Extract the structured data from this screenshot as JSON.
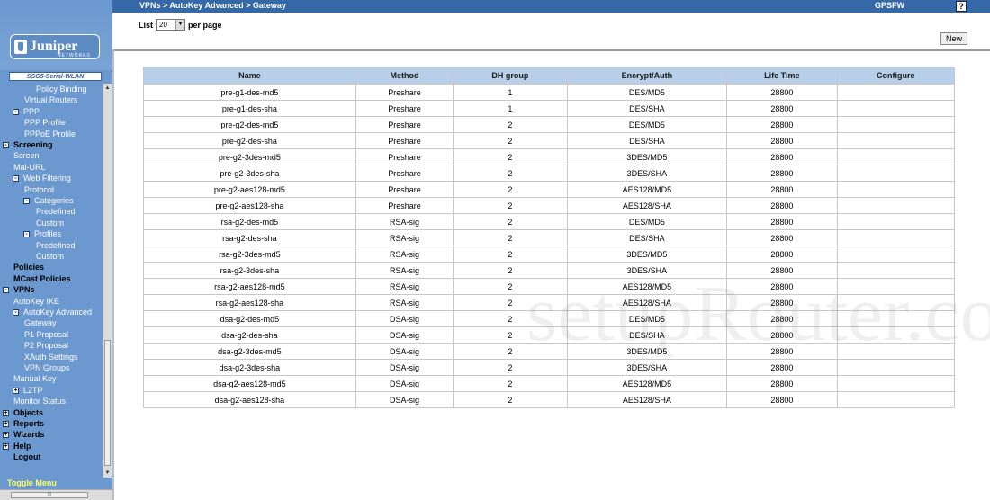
{
  "topbar": {
    "breadcrumb": "VPNs > AutoKey Advanced > Gateway",
    "device_name": "GPSFW",
    "help_label": "?"
  },
  "logo": {
    "text": "Juniper",
    "sub": "NETWORKS",
    "device_label": "SSG5-Serial-WLAN"
  },
  "menu": [
    {
      "label": "Policy Binding",
      "level": 3,
      "bold": false
    },
    {
      "label": "Virtual Routers",
      "level": 2,
      "bold": false
    },
    {
      "label": "PPP",
      "level": 1,
      "bold": false,
      "box": "-"
    },
    {
      "label": "PPP Profile",
      "level": 2,
      "bold": false
    },
    {
      "label": "PPPoE Profile",
      "level": 2,
      "bold": false
    },
    {
      "label": "Screening",
      "level": 0,
      "bold": true,
      "box": "-"
    },
    {
      "label": "Screen",
      "level": 1,
      "bold": false
    },
    {
      "label": "Mal-URL",
      "level": 1,
      "bold": false
    },
    {
      "label": "Web Filtering",
      "level": 1,
      "bold": false,
      "box": "-"
    },
    {
      "label": "Protocol",
      "level": 2,
      "bold": false
    },
    {
      "label": "Categories",
      "level": 2,
      "bold": false,
      "box": "-"
    },
    {
      "label": "Predefined",
      "level": 3,
      "bold": false
    },
    {
      "label": "Custom",
      "level": 3,
      "bold": false
    },
    {
      "label": "Profiles",
      "level": 2,
      "bold": false,
      "box": "-"
    },
    {
      "label": "Predefined",
      "level": 3,
      "bold": false
    },
    {
      "label": "Custom",
      "level": 3,
      "bold": false
    },
    {
      "label": "Policies",
      "level": 0,
      "bold": true
    },
    {
      "label": "MCast Policies",
      "level": 0,
      "bold": true
    },
    {
      "label": "VPNs",
      "level": 0,
      "bold": true,
      "box": "-"
    },
    {
      "label": "AutoKey IKE",
      "level": 1,
      "bold": false
    },
    {
      "label": "AutoKey Advanced",
      "level": 1,
      "bold": false,
      "box": "-"
    },
    {
      "label": "Gateway",
      "level": 2,
      "bold": false
    },
    {
      "label": "P1 Proposal",
      "level": 2,
      "bold": false
    },
    {
      "label": "P2 Proposal",
      "level": 2,
      "bold": false
    },
    {
      "label": "XAuth Settings",
      "level": 2,
      "bold": false
    },
    {
      "label": "VPN Groups",
      "level": 2,
      "bold": false
    },
    {
      "label": "Manual Key",
      "level": 1,
      "bold": false
    },
    {
      "label": "L2TP",
      "level": 1,
      "bold": false,
      "box": "+"
    },
    {
      "label": "Monitor Status",
      "level": 1,
      "bold": false
    },
    {
      "label": "Objects",
      "level": 0,
      "bold": true,
      "box": "+"
    },
    {
      "label": "Reports",
      "level": 0,
      "bold": true,
      "box": "+"
    },
    {
      "label": "Wizards",
      "level": 0,
      "bold": true,
      "box": "+"
    },
    {
      "label": "Help",
      "level": 0,
      "bold": true,
      "box": "+"
    },
    {
      "label": "Logout",
      "level": 0,
      "bold": true
    }
  ],
  "toggle_menu_label": "Toggle Menu",
  "list": {
    "prefix": "List",
    "value": "20",
    "suffix": "per page"
  },
  "new_button_label": "New",
  "table": {
    "columns": [
      "Name",
      "Method",
      "DH group",
      "Encrypt/Auth",
      "Life Time",
      "Configure"
    ],
    "rows": [
      [
        "pre-g1-des-md5",
        "Preshare",
        "1",
        "DES/MD5",
        "28800",
        ""
      ],
      [
        "pre-g1-des-sha",
        "Preshare",
        "1",
        "DES/SHA",
        "28800",
        ""
      ],
      [
        "pre-g2-des-md5",
        "Preshare",
        "2",
        "DES/MD5",
        "28800",
        ""
      ],
      [
        "pre-g2-des-sha",
        "Preshare",
        "2",
        "DES/SHA",
        "28800",
        ""
      ],
      [
        "pre-g2-3des-md5",
        "Preshare",
        "2",
        "3DES/MD5",
        "28800",
        ""
      ],
      [
        "pre-g2-3des-sha",
        "Preshare",
        "2",
        "3DES/SHA",
        "28800",
        ""
      ],
      [
        "pre-g2-aes128-md5",
        "Preshare",
        "2",
        "AES128/MD5",
        "28800",
        ""
      ],
      [
        "pre-g2-aes128-sha",
        "Preshare",
        "2",
        "AES128/SHA",
        "28800",
        ""
      ],
      [
        "rsa-g2-des-md5",
        "RSA-sig",
        "2",
        "DES/MD5",
        "28800",
        ""
      ],
      [
        "rsa-g2-des-sha",
        "RSA-sig",
        "2",
        "DES/SHA",
        "28800",
        ""
      ],
      [
        "rsa-g2-3des-md5",
        "RSA-sig",
        "2",
        "3DES/MD5",
        "28800",
        ""
      ],
      [
        "rsa-g2-3des-sha",
        "RSA-sig",
        "2",
        "3DES/SHA",
        "28800",
        ""
      ],
      [
        "rsa-g2-aes128-md5",
        "RSA-sig",
        "2",
        "AES128/MD5",
        "28800",
        ""
      ],
      [
        "rsa-g2-aes128-sha",
        "RSA-sig",
        "2",
        "AES128/SHA",
        "28800",
        ""
      ],
      [
        "dsa-g2-des-md5",
        "DSA-sig",
        "2",
        "DES/MD5",
        "28800",
        ""
      ],
      [
        "dsa-g2-des-sha",
        "DSA-sig",
        "2",
        "DES/SHA",
        "28800",
        ""
      ],
      [
        "dsa-g2-3des-md5",
        "DSA-sig",
        "2",
        "3DES/MD5",
        "28800",
        ""
      ],
      [
        "dsa-g2-3des-sha",
        "DSA-sig",
        "2",
        "3DES/SHA",
        "28800",
        ""
      ],
      [
        "dsa-g2-aes128-md5",
        "DSA-sig",
        "2",
        "AES128/MD5",
        "28800",
        ""
      ],
      [
        "dsa-g2-aes128-sha",
        "DSA-sig",
        "2",
        "AES128/SHA",
        "28800",
        ""
      ]
    ]
  },
  "watermark": "setupRouter.co",
  "colors": {
    "sidebar": "#6b98cf",
    "topbar": "#3568a6",
    "table_header": "#b7cfe8"
  }
}
